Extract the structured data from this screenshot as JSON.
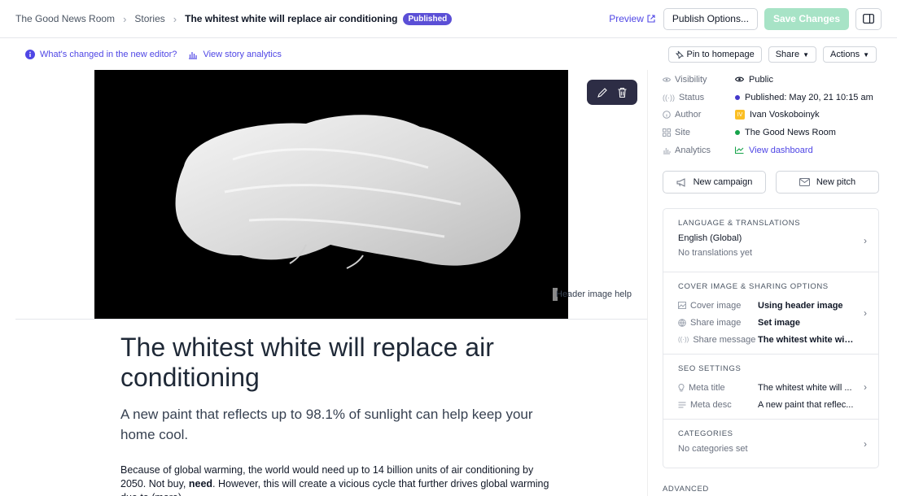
{
  "breadcrumb": {
    "site": "The Good News Room",
    "section": "Stories",
    "current": "The whitest white will replace air conditioning",
    "badge": "Published"
  },
  "toolbar": {
    "preview": "Preview",
    "publish_options": "Publish Options...",
    "save": "Save Changes"
  },
  "subbar": {
    "whats_changed": "What's changed in the new editor?",
    "analytics": "View story analytics",
    "pin": "Pin to homepage",
    "share": "Share",
    "actions": "Actions"
  },
  "editor": {
    "image_help": "Header image help",
    "title": "The whitest white will replace air conditioning",
    "subtitle": "A new paint that reflects up to 98.1% of sunlight can help keep your home cool.",
    "body_before": "Because of global warming, the world would need up to 14 billion units of air conditioning by 2050. Not buy, ",
    "body_bold": "need",
    "body_after": ". However, this will create a vicious cycle that further drives global warming due to (more)"
  },
  "meta": [
    {
      "label": "Visibility",
      "value": "Public",
      "icon": "eye-icon"
    },
    {
      "label": "Status",
      "value": "Published: May 20, 21 10:15 am",
      "icon": "broadcast-icon"
    },
    {
      "label": "Author",
      "value": "Ivan Voskoboinyk",
      "icon": "info-icon"
    },
    {
      "label": "Site",
      "value": "The Good News Room",
      "icon": "grid-icon"
    },
    {
      "label": "Analytics",
      "value": "View dashboard",
      "icon": "bar-chart-icon"
    }
  ],
  "author_initials": "IV",
  "actions": {
    "campaign": "New campaign",
    "pitch": "New pitch"
  },
  "language": {
    "heading": "LANGUAGE & TRANSLATIONS",
    "value": "English (Global)",
    "note": "No translations yet"
  },
  "cover": {
    "heading": "COVER IMAGE & SHARING OPTIONS",
    "rows": [
      {
        "k": "Cover image",
        "v": "Using header image"
      },
      {
        "k": "Share image",
        "v": "Set image"
      },
      {
        "k": "Share message",
        "v": "The whitest white will ..."
      }
    ]
  },
  "seo": {
    "heading": "SEO SETTINGS",
    "rows": [
      {
        "k": "Meta title",
        "v": "The whitest white will ..."
      },
      {
        "k": "Meta desc",
        "v": "A new paint that reflec..."
      }
    ]
  },
  "categories": {
    "heading": "CATEGORIES",
    "note": "No categories set"
  },
  "advanced": "ADVANCED",
  "colors": {
    "accent": "#4f46e5",
    "badge": "#5b4fd6",
    "save": "#a7e3c6",
    "published_dot": "#4338ca",
    "site_dot": "#16a34a",
    "analytics": "#16a34a"
  }
}
